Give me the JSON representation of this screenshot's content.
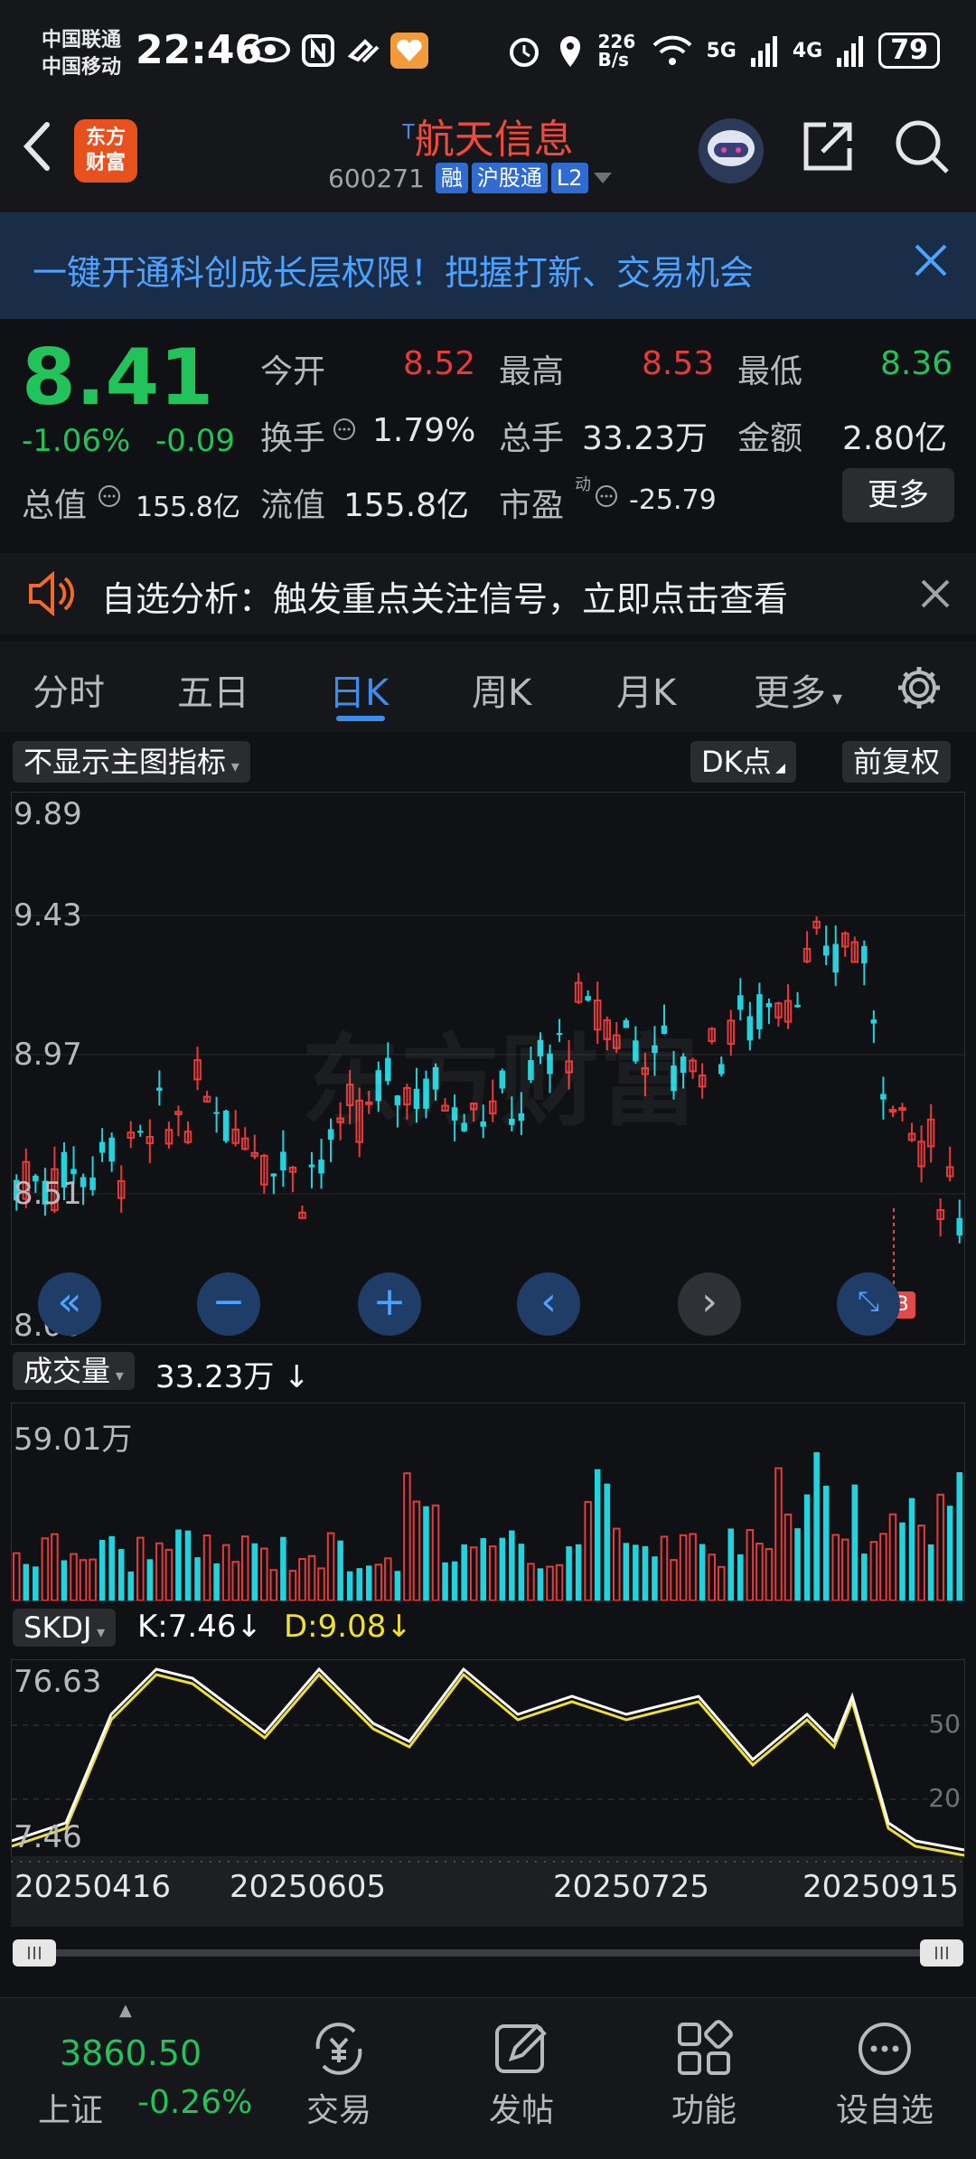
{
  "status": {
    "carrier1": "中国联通",
    "carrier2": "中国移动",
    "time": "22:46",
    "net_speed": "226 B/s",
    "net1": "5G",
    "net2": "4G",
    "battery": "79"
  },
  "header": {
    "logo_line1": "东方",
    "logo_line2": "财富",
    "title_mark": "T",
    "title": "航天信息",
    "code": "600271",
    "tags": [
      "融",
      "沪股通",
      "L2"
    ]
  },
  "banner": {
    "text": "一键开通科创成长层权限！把握打新、交易机会"
  },
  "quote": {
    "price": "8.41",
    "change_pct": "-1.06%",
    "change": "-0.09",
    "open_label": "今开",
    "open": "8.52",
    "high_label": "最高",
    "high": "8.53",
    "low_label": "最低",
    "low": "8.36",
    "turnover_label": "换手",
    "turnover": "1.79%",
    "volume_label": "总手",
    "volume": "33.23万",
    "amount_label": "金额",
    "amount": "2.80亿",
    "mktcap_label": "总值",
    "mktcap": "155.8亿",
    "float_label": "流值",
    "float": "155.8亿",
    "pe_label": "市盈",
    "pe_mark": "动",
    "pe": "-25.79",
    "more": "更多"
  },
  "alert": {
    "text": "自选分析：触发重点关注信号，立即点击查看"
  },
  "tabs": [
    "分时",
    "五日",
    "日K",
    "周K",
    "月K",
    "更多"
  ],
  "active_tab": "日K",
  "chart_toolbar": {
    "indicator": "不显示主图指标",
    "dk": "DK点",
    "adjust": "前复权"
  },
  "kline": {
    "yticks": [
      "9.89",
      "9.43",
      "8.97",
      "8.51",
      "8.06"
    ],
    "watermark": "东方财富",
    "marker": "B"
  },
  "volume": {
    "label": "成交量",
    "value": "33.23万",
    "ymax": "59.01万"
  },
  "skdj": {
    "label": "SKDJ",
    "k": "K:7.46",
    "d": "D:9.08",
    "ymax": "76.63",
    "ymin": "7.46",
    "ref50": "50",
    "ref20": "20",
    "xticks": [
      "20250416",
      "20250605",
      "20250725",
      "20250915"
    ]
  },
  "bottom": {
    "index_value": "3860.50",
    "index_name": "上证",
    "index_change": "-0.26%",
    "nav": [
      "交易",
      "发帖",
      "功能",
      "设自选"
    ]
  },
  "colors": {
    "up": "#e83a3a",
    "down": "#22d3de",
    "k_line": "#ffffff",
    "d_line": "#f0e030",
    "accent": "#3b8ef0"
  }
}
